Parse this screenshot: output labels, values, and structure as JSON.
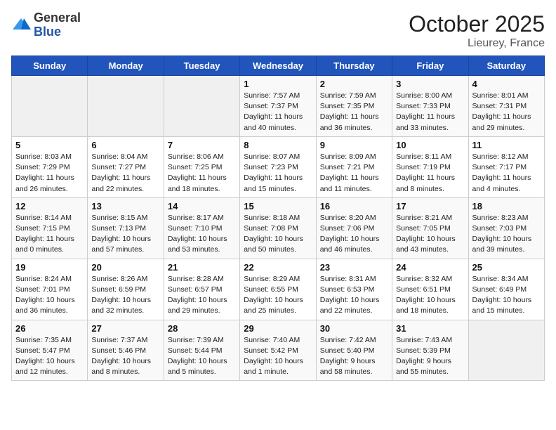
{
  "header": {
    "logo_line1": "General",
    "logo_line2": "Blue",
    "month": "October 2025",
    "location": "Lieurey, France"
  },
  "days_of_week": [
    "Sunday",
    "Monday",
    "Tuesday",
    "Wednesday",
    "Thursday",
    "Friday",
    "Saturday"
  ],
  "weeks": [
    [
      {
        "day": "",
        "info": ""
      },
      {
        "day": "",
        "info": ""
      },
      {
        "day": "",
        "info": ""
      },
      {
        "day": "1",
        "info": "Sunrise: 7:57 AM\nSunset: 7:37 PM\nDaylight: 11 hours\nand 40 minutes."
      },
      {
        "day": "2",
        "info": "Sunrise: 7:59 AM\nSunset: 7:35 PM\nDaylight: 11 hours\nand 36 minutes."
      },
      {
        "day": "3",
        "info": "Sunrise: 8:00 AM\nSunset: 7:33 PM\nDaylight: 11 hours\nand 33 minutes."
      },
      {
        "day": "4",
        "info": "Sunrise: 8:01 AM\nSunset: 7:31 PM\nDaylight: 11 hours\nand 29 minutes."
      }
    ],
    [
      {
        "day": "5",
        "info": "Sunrise: 8:03 AM\nSunset: 7:29 PM\nDaylight: 11 hours\nand 26 minutes."
      },
      {
        "day": "6",
        "info": "Sunrise: 8:04 AM\nSunset: 7:27 PM\nDaylight: 11 hours\nand 22 minutes."
      },
      {
        "day": "7",
        "info": "Sunrise: 8:06 AM\nSunset: 7:25 PM\nDaylight: 11 hours\nand 18 minutes."
      },
      {
        "day": "8",
        "info": "Sunrise: 8:07 AM\nSunset: 7:23 PM\nDaylight: 11 hours\nand 15 minutes."
      },
      {
        "day": "9",
        "info": "Sunrise: 8:09 AM\nSunset: 7:21 PM\nDaylight: 11 hours\nand 11 minutes."
      },
      {
        "day": "10",
        "info": "Sunrise: 8:11 AM\nSunset: 7:19 PM\nDaylight: 11 hours\nand 8 minutes."
      },
      {
        "day": "11",
        "info": "Sunrise: 8:12 AM\nSunset: 7:17 PM\nDaylight: 11 hours\nand 4 minutes."
      }
    ],
    [
      {
        "day": "12",
        "info": "Sunrise: 8:14 AM\nSunset: 7:15 PM\nDaylight: 11 hours\nand 0 minutes."
      },
      {
        "day": "13",
        "info": "Sunrise: 8:15 AM\nSunset: 7:13 PM\nDaylight: 10 hours\nand 57 minutes."
      },
      {
        "day": "14",
        "info": "Sunrise: 8:17 AM\nSunset: 7:10 PM\nDaylight: 10 hours\nand 53 minutes."
      },
      {
        "day": "15",
        "info": "Sunrise: 8:18 AM\nSunset: 7:08 PM\nDaylight: 10 hours\nand 50 minutes."
      },
      {
        "day": "16",
        "info": "Sunrise: 8:20 AM\nSunset: 7:06 PM\nDaylight: 10 hours\nand 46 minutes."
      },
      {
        "day": "17",
        "info": "Sunrise: 8:21 AM\nSunset: 7:05 PM\nDaylight: 10 hours\nand 43 minutes."
      },
      {
        "day": "18",
        "info": "Sunrise: 8:23 AM\nSunset: 7:03 PM\nDaylight: 10 hours\nand 39 minutes."
      }
    ],
    [
      {
        "day": "19",
        "info": "Sunrise: 8:24 AM\nSunset: 7:01 PM\nDaylight: 10 hours\nand 36 minutes."
      },
      {
        "day": "20",
        "info": "Sunrise: 8:26 AM\nSunset: 6:59 PM\nDaylight: 10 hours\nand 32 minutes."
      },
      {
        "day": "21",
        "info": "Sunrise: 8:28 AM\nSunset: 6:57 PM\nDaylight: 10 hours\nand 29 minutes."
      },
      {
        "day": "22",
        "info": "Sunrise: 8:29 AM\nSunset: 6:55 PM\nDaylight: 10 hours\nand 25 minutes."
      },
      {
        "day": "23",
        "info": "Sunrise: 8:31 AM\nSunset: 6:53 PM\nDaylight: 10 hours\nand 22 minutes."
      },
      {
        "day": "24",
        "info": "Sunrise: 8:32 AM\nSunset: 6:51 PM\nDaylight: 10 hours\nand 18 minutes."
      },
      {
        "day": "25",
        "info": "Sunrise: 8:34 AM\nSunset: 6:49 PM\nDaylight: 10 hours\nand 15 minutes."
      }
    ],
    [
      {
        "day": "26",
        "info": "Sunrise: 7:35 AM\nSunset: 5:47 PM\nDaylight: 10 hours\nand 12 minutes."
      },
      {
        "day": "27",
        "info": "Sunrise: 7:37 AM\nSunset: 5:46 PM\nDaylight: 10 hours\nand 8 minutes."
      },
      {
        "day": "28",
        "info": "Sunrise: 7:39 AM\nSunset: 5:44 PM\nDaylight: 10 hours\nand 5 minutes."
      },
      {
        "day": "29",
        "info": "Sunrise: 7:40 AM\nSunset: 5:42 PM\nDaylight: 10 hours\nand 1 minute."
      },
      {
        "day": "30",
        "info": "Sunrise: 7:42 AM\nSunset: 5:40 PM\nDaylight: 9 hours\nand 58 minutes."
      },
      {
        "day": "31",
        "info": "Sunrise: 7:43 AM\nSunset: 5:39 PM\nDaylight: 9 hours\nand 55 minutes."
      },
      {
        "day": "",
        "info": ""
      }
    ]
  ]
}
